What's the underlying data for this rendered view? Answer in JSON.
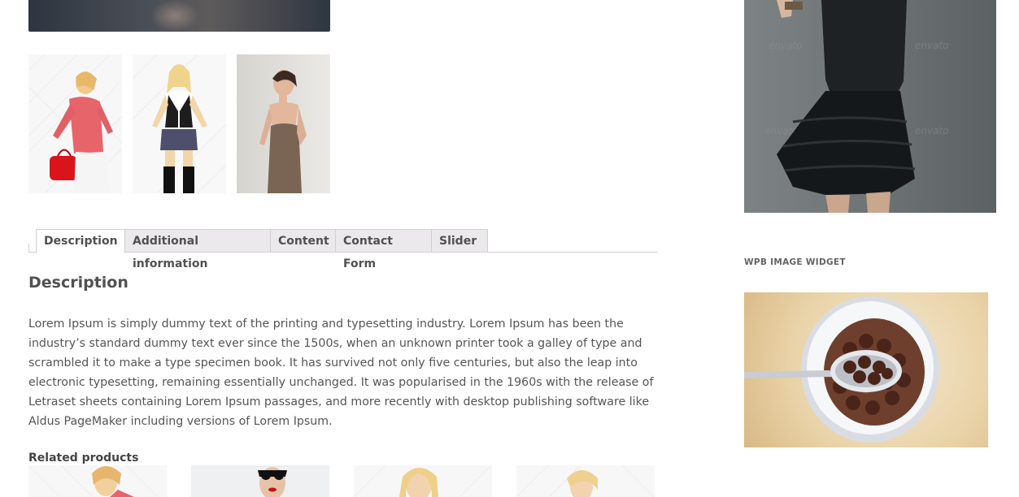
{
  "gallery": {
    "main_image_alt": "product main image",
    "thumbnails": [
      "thumbnail 1",
      "thumbnail 2",
      "thumbnail 3"
    ],
    "watermark": "envato"
  },
  "tabs": [
    {
      "label": "Description",
      "active": true
    },
    {
      "label": "Additional information",
      "active": false
    },
    {
      "label": "Content",
      "active": false
    },
    {
      "label": "Contact Form",
      "active": false
    },
    {
      "label": "Slider",
      "active": false
    }
  ],
  "description": {
    "heading": "Description",
    "body": "Lorem Ipsum is simply dummy text of the printing and typesetting industry. Lorem Ipsum has been the industry’s standard dummy text ever since the 1500s, when an unknown printer took a galley of type and scrambled it to make a type specimen book. It has survived not only five centuries, but also the leap into electronic typesetting, remaining essentially unchanged. It was popularised in the 1960s with the release of Letraset sheets containing Lorem Ipsum passages, and more recently with desktop publishing software like Aldus PageMaker including versions of Lorem Ipsum."
  },
  "related": {
    "heading": "Related products"
  },
  "sidebar": {
    "widget_title": "WPB IMAGE WIDGET"
  },
  "colors": {
    "tab_bg": "#ebe9eb",
    "tab_border": "#d3ced2",
    "text": "#555555"
  }
}
